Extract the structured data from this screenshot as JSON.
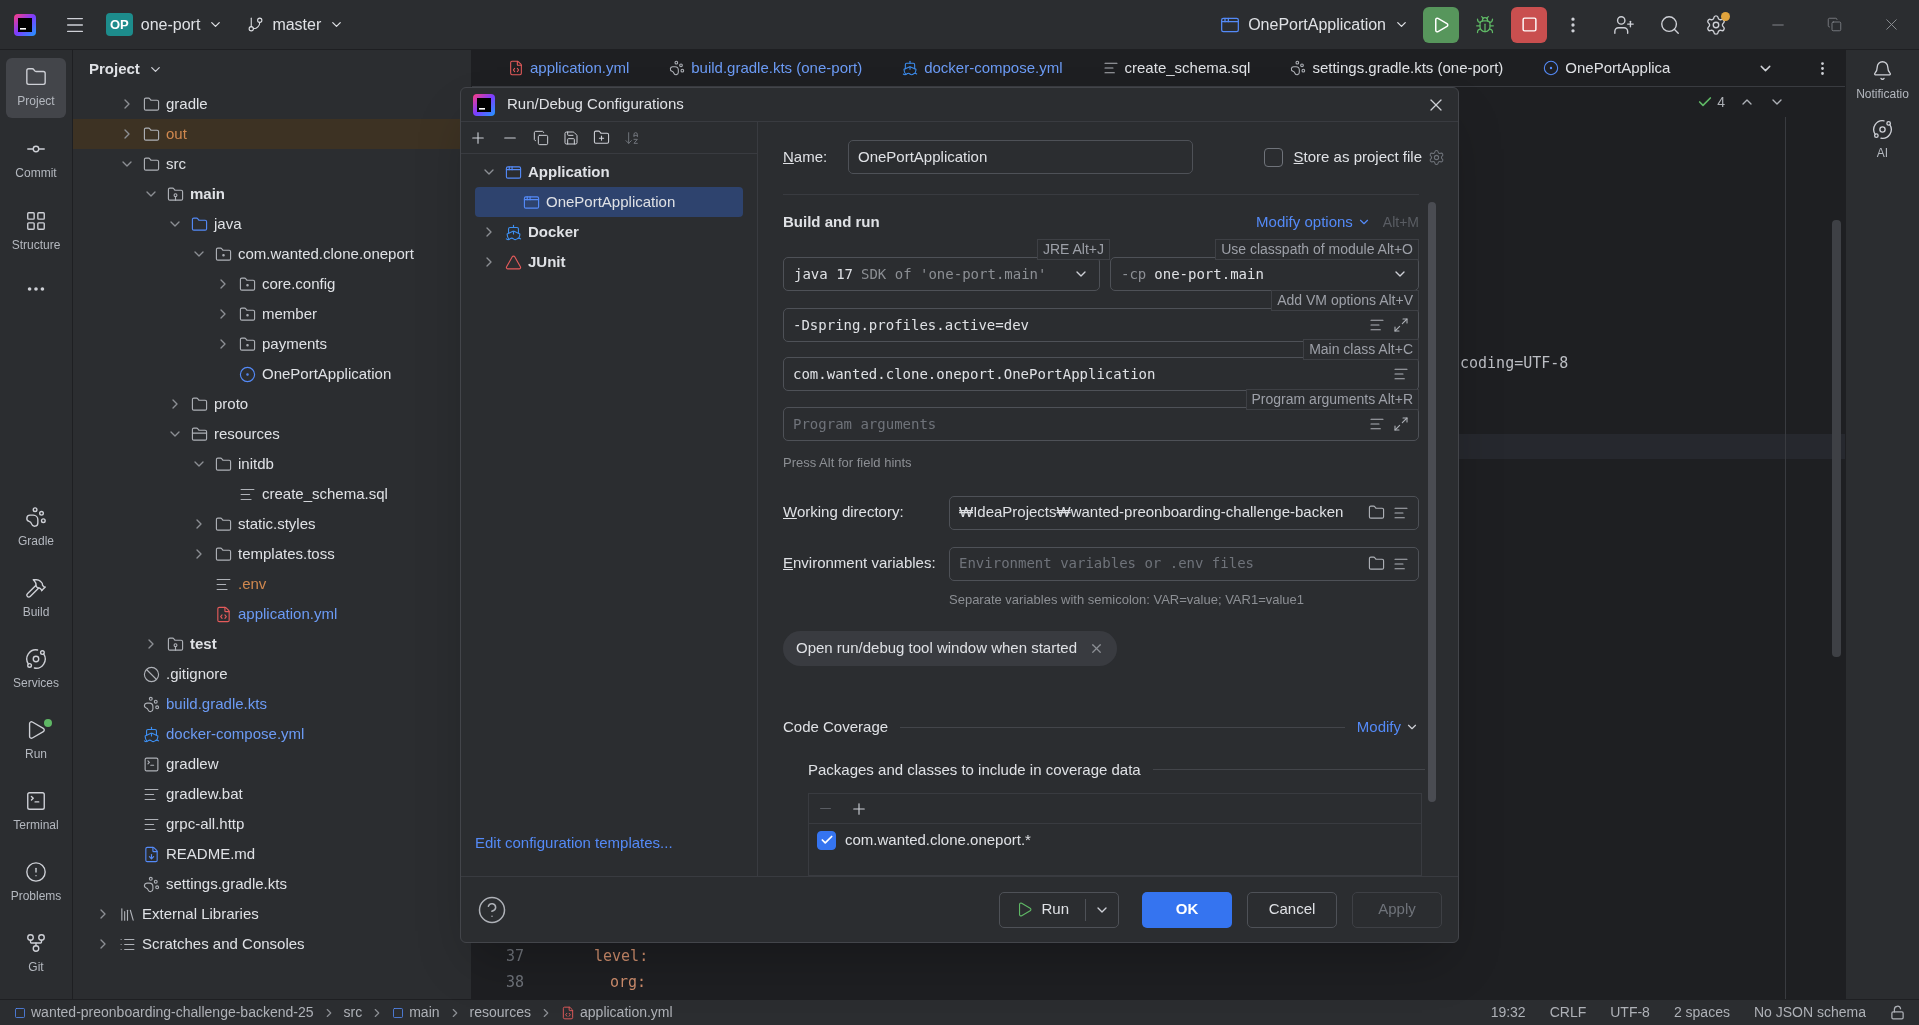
{
  "topbar": {
    "project_badge": "OP",
    "project": "one-port",
    "branch": "master",
    "run_config": "OnePortApplication",
    "updates_available": true
  },
  "tool_strip": {
    "top": [
      {
        "label": "Project",
        "selected": true
      },
      {
        "label": "Commit",
        "selected": false
      },
      {
        "label": "Structure",
        "selected": false
      }
    ],
    "bottom": [
      {
        "label": "Gradle",
        "running": false
      },
      {
        "label": "Build",
        "running": false
      },
      {
        "label": "Services",
        "running": false
      },
      {
        "label": "Run",
        "running": true
      },
      {
        "label": "Terminal",
        "running": false
      },
      {
        "label": "Problems",
        "running": false
      },
      {
        "label": "Git",
        "running": false
      }
    ]
  },
  "project": {
    "title": "Project",
    "root_children": [
      {
        "label": "gradle",
        "kind": "folder",
        "expanded": false
      },
      {
        "label": "out",
        "kind": "folder",
        "expanded": false,
        "excluded": true,
        "color": "#d0884f"
      },
      {
        "label": "src",
        "kind": "folder",
        "expanded": true,
        "children": [
          {
            "label": "main",
            "kind": "source-root",
            "expanded": true,
            "children": [
              {
                "label": "java",
                "kind": "java-folder",
                "expanded": true,
                "children": [
                  {
                    "label": "com.wanted.clone.oneport",
                    "kind": "package",
                    "expanded": true,
                    "children": [
                      {
                        "label": "core.config",
                        "kind": "package",
                        "expanded": false
                      },
                      {
                        "label": "member",
                        "kind": "package",
                        "expanded": false
                      },
                      {
                        "label": "payments",
                        "kind": "package",
                        "expanded": false
                      },
                      {
                        "label": "OnePortApplication",
                        "kind": "class"
                      }
                    ]
                  }
                ]
              },
              {
                "label": "proto",
                "kind": "folder",
                "expanded": false
              },
              {
                "label": "resources",
                "kind": "resources",
                "expanded": true,
                "children": [
                  {
                    "label": "initdb",
                    "kind": "folder",
                    "expanded": true,
                    "children": [
                      {
                        "label": "create_schema.sql",
                        "kind": "text"
                      }
                    ]
                  },
                  {
                    "label": "static.styles",
                    "kind": "folder",
                    "expanded": false
                  },
                  {
                    "label": "templates.toss",
                    "kind": "folder",
                    "expanded": false
                  },
                  {
                    "label": ".env",
                    "kind": "text",
                    "color": "#d0884f"
                  },
                  {
                    "label": "application.yml",
                    "kind": "yaml",
                    "color": "#6c9bf5"
                  }
                ]
              }
            ]
          },
          {
            "label": "test",
            "kind": "source-root",
            "expanded": false
          }
        ]
      },
      {
        "label": ".gitignore",
        "kind": "ignore"
      },
      {
        "label": "build.gradle.kts",
        "kind": "gradle",
        "color": "#6c9bf5"
      },
      {
        "label": "docker-compose.yml",
        "kind": "docker",
        "color": "#6c9bf5"
      },
      {
        "label": "gradlew",
        "kind": "terminal"
      },
      {
        "label": "gradlew.bat",
        "kind": "text"
      },
      {
        "label": "grpc-all.http",
        "kind": "text"
      },
      {
        "label": "README.md",
        "kind": "markdown"
      },
      {
        "label": "settings.gradle.kts",
        "kind": "gradle"
      }
    ],
    "other_roots": [
      {
        "label": "External Libraries",
        "kind": "libraries",
        "expanded": false
      },
      {
        "label": "Scratches and Consoles",
        "kind": "scratches",
        "expanded": false
      }
    ]
  },
  "editor": {
    "tabs": [
      {
        "label": "application.yml",
        "kind": "yaml",
        "color": "#6c9bf5"
      },
      {
        "label": "build.gradle.kts (one-port)",
        "kind": "gradle",
        "color": "#6c9bf5"
      },
      {
        "label": "docker-compose.yml",
        "kind": "docker",
        "color": "#6c9bf5"
      },
      {
        "label": "create_schema.sql",
        "kind": "text"
      },
      {
        "label": "settings.gradle.kts (one-port)",
        "kind": "gradle"
      },
      {
        "label": "OnePortApplica",
        "kind": "class"
      }
    ],
    "problems": "4",
    "fragment": "coding=UTF-8",
    "lines": [
      {
        "number": "37",
        "text": "level:"
      },
      {
        "number": "38",
        "text": "org:"
      }
    ]
  },
  "right_strip": [
    {
      "label": "Notificatio"
    },
    {
      "label": "AI"
    }
  ],
  "dialog": {
    "title": "Run/Debug Configurations",
    "config_tree": [
      {
        "label": "Application",
        "kind": "application",
        "expanded": true,
        "selected": false,
        "children": [
          {
            "label": "OnePortApplication",
            "kind": "config",
            "selected": true
          }
        ]
      },
      {
        "label": "Docker",
        "kind": "docker",
        "expanded": false,
        "selected": false
      },
      {
        "label": "JUnit",
        "kind": "junit",
        "expanded": false,
        "selected": false
      }
    ],
    "templates_link": "Edit configuration templates...",
    "name_label": "Name:",
    "name_value": "OnePortApplication",
    "store_label": "Store as project file",
    "store_checked": false,
    "section": "Build and run",
    "modify_options": "Modify options",
    "modify_shortcut": "Alt+M",
    "jre": {
      "prefix": "java 17",
      "detail": "SDK of 'one-port.main'",
      "hint": "JRE Alt+J"
    },
    "classpath": {
      "prefix": "-cp",
      "value": "one-port.main",
      "hint": "Use classpath of module Alt+O"
    },
    "vm_options": {
      "value": "-Dspring.profiles.active=dev",
      "hint": "Add VM options Alt+V"
    },
    "main_class": {
      "value": "com.wanted.clone.oneport.OnePortApplication",
      "hint": "Main class Alt+C"
    },
    "program_args": {
      "placeholder": "Program arguments",
      "hint": "Program arguments Alt+R"
    },
    "field_hint": "Press Alt for field hints",
    "working_dir": {
      "label": "Working directory:",
      "value": "₩IdeaProjects₩wanted-preonboarding-challenge-backen"
    },
    "env": {
      "label": "Environment variables:",
      "placeholder": "Environment variables or .env files",
      "hint": "Separate variables with semicolon: VAR=value; VAR1=value1"
    },
    "chip": "Open run/debug tool window when started",
    "coverage": {
      "title": "Code Coverage",
      "modify": "Modify",
      "subtitle": "Packages and classes to include in coverage data",
      "patterns": [
        {
          "label": "com.wanted.clone.oneport.*",
          "checked": true
        }
      ]
    },
    "run_button": "Run",
    "ok_button": "OK",
    "cancel_button": "Cancel",
    "apply_button": {
      "label": "Apply",
      "disabled": true
    }
  },
  "status_bar": {
    "breadcrumbs": [
      {
        "label": "wanted-preonboarding-challenge-backend-25",
        "kind": "module"
      },
      {
        "label": "src",
        "kind": "none"
      },
      {
        "label": "main",
        "kind": "module"
      },
      {
        "label": "resources",
        "kind": "none"
      },
      {
        "label": "application.yml",
        "kind": "yaml"
      }
    ],
    "items": [
      "19:32",
      "CRLF",
      "UTF-8",
      "2 spaces",
      "No JSON schema"
    ]
  }
}
